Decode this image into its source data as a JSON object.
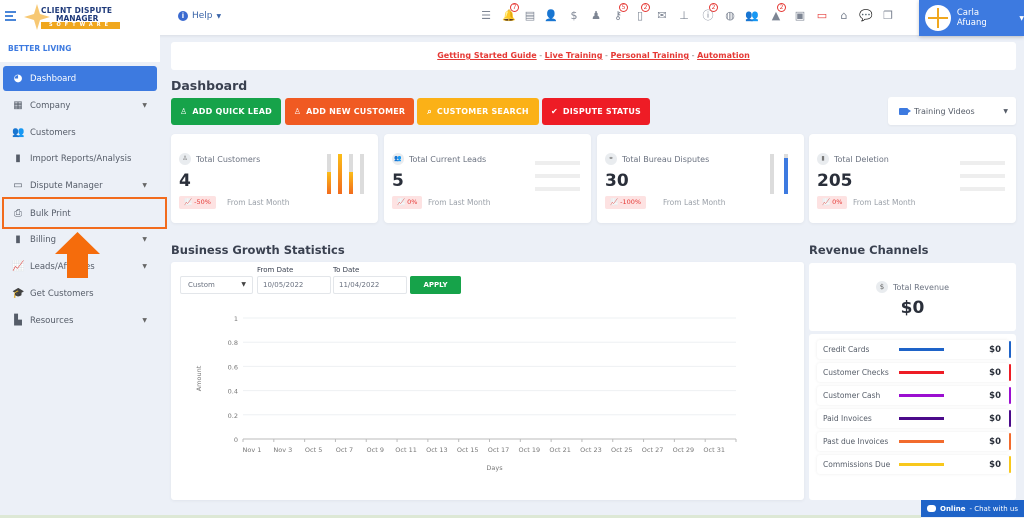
{
  "topbar": {
    "logo": {
      "line1": "CLIENT DISPUTE",
      "line2": "MANAGER",
      "line3": "SOFTWARE"
    },
    "help_label": "Help",
    "icons": [
      {
        "name": "tasks-icon",
        "glyph": "☰",
        "badge": null
      },
      {
        "name": "bell-icon",
        "glyph": "🔔",
        "badge": "7"
      },
      {
        "name": "invoice-icon",
        "glyph": "▤",
        "badge": null
      },
      {
        "name": "agent-icon",
        "glyph": "👤",
        "badge": null
      },
      {
        "name": "dollar-icon",
        "glyph": "$",
        "badge": null
      },
      {
        "name": "user-tie-icon",
        "glyph": "♟",
        "badge": null
      },
      {
        "name": "key-icon",
        "glyph": "⚷",
        "badge": "5"
      },
      {
        "name": "document-icon",
        "glyph": "▯",
        "badge": "2"
      },
      {
        "name": "envelope-icon",
        "glyph": "✉",
        "badge": null
      },
      {
        "name": "sitemap-icon",
        "glyph": "⊥",
        "badge": null
      },
      {
        "name": "info-icon",
        "glyph": "ⓘ",
        "badge": "2"
      },
      {
        "name": "globe-icon",
        "glyph": "◍",
        "badge": null
      },
      {
        "name": "users-icon",
        "glyph": "👥",
        "badge": null
      },
      {
        "name": "warning-icon",
        "glyph": "▲",
        "badge": "2"
      },
      {
        "name": "inbox-icon",
        "glyph": "▣",
        "badge": null
      },
      {
        "name": "money-bill-icon",
        "glyph": "▭",
        "badge": null
      },
      {
        "name": "tray-icon",
        "glyph": "⌂",
        "badge": null
      },
      {
        "name": "comments-icon",
        "glyph": "💬",
        "badge": null
      },
      {
        "name": "copy-icon",
        "glyph": "❐",
        "badge": null
      }
    ],
    "user_name": "Carla Afuang"
  },
  "sidebar": {
    "company": "BETTER LIVING",
    "items": [
      {
        "label": "Dashboard",
        "icon": "◕",
        "active": true,
        "caret": false
      },
      {
        "label": "Company",
        "icon": "▦",
        "active": false,
        "caret": true
      },
      {
        "label": "Customers",
        "icon": "👥",
        "active": false,
        "caret": false
      },
      {
        "label": "Import Reports/Analysis",
        "icon": "▮",
        "active": false,
        "caret": false
      },
      {
        "label": "Dispute Manager",
        "icon": "▭",
        "active": false,
        "caret": true
      },
      {
        "label": "Bulk Print",
        "icon": "⎙",
        "active": false,
        "caret": false
      },
      {
        "label": "Billing",
        "icon": "▮",
        "active": false,
        "caret": true
      },
      {
        "label": "Leads/Affiliates",
        "icon": "📈",
        "active": false,
        "caret": true
      },
      {
        "label": "Get Customers",
        "icon": "🎓",
        "active": false,
        "caret": false
      },
      {
        "label": "Resources",
        "icon": "▙",
        "active": false,
        "caret": true
      }
    ]
  },
  "banner": {
    "links": [
      "Getting Started Guide",
      "Live Training",
      "Personal Training",
      "Automation"
    ],
    "separator": " - "
  },
  "page_title": "Dashboard",
  "quick_buttons": [
    {
      "label": "ADD QUICK LEAD",
      "icon": "♙",
      "color": "#16a34a"
    },
    {
      "label": "ADD NEW CUSTOMER",
      "icon": "♙",
      "color": "#f05a22"
    },
    {
      "label": "CUSTOMER SEARCH",
      "icon": "⌕",
      "color": "#fbb117"
    },
    {
      "label": "DISPUTE STATUS",
      "icon": "✔",
      "color": "#ee1c25"
    }
  ],
  "training_videos": "Training Videos",
  "stats": [
    {
      "title": "Total Customers",
      "value": "4",
      "change": "-50%",
      "from": "From Last Month",
      "icon": "♙",
      "bars": [
        0.55,
        1.0,
        0.55,
        0.0
      ],
      "bar_style": "orange"
    },
    {
      "title": "Total Current Leads",
      "value": "5",
      "change": "0%",
      "from": "From Last Month",
      "icon": "👥",
      "bar_style": "lines"
    },
    {
      "title": "Total Bureau Disputes",
      "value": "30",
      "change": "-100%",
      "from": "From Last Month",
      "icon": "⚭",
      "bars": [
        0.0,
        0.9
      ],
      "bar_style": "blue"
    },
    {
      "title": "Total Deletion",
      "value": "205",
      "change": "0%",
      "from": "From Last Month",
      "icon": "▮",
      "bar_style": "lines"
    }
  ],
  "growth": {
    "title": "Business Growth Statistics",
    "range_select": "Custom",
    "from_label": "From Date",
    "from_value": "10/05/2022",
    "to_label": "To Date",
    "to_value": "11/04/2022",
    "apply_label": "APPLY"
  },
  "chart_data": {
    "type": "line",
    "title": "",
    "xlabel": "Days",
    "ylabel": "Amount",
    "categories": [
      "Nov 1",
      "Nov 3",
      "Oct 5",
      "Oct 7",
      "Oct 9",
      "Oct 11",
      "Oct 13",
      "Oct 15",
      "Oct 17",
      "Oct 19",
      "Oct 21",
      "Oct 23",
      "Oct 25",
      "Oct 27",
      "Oct 29",
      "Oct 31"
    ],
    "series": [],
    "yticks": [
      "0",
      "0.2",
      "0.4",
      "0.6",
      "0.8",
      "1"
    ],
    "ylim": [
      0,
      1
    ],
    "grid": true
  },
  "revenue": {
    "title": "Revenue Channels",
    "total_label": "Total Revenue",
    "total_value": "$0",
    "channels": [
      {
        "label": "Credit Cards",
        "value": "$0",
        "color": "#1e63c8"
      },
      {
        "label": "Customer Checks",
        "value": "$0",
        "color": "#ee1c25"
      },
      {
        "label": "Customer Cash",
        "value": "$0",
        "color": "#9b0fd0"
      },
      {
        "label": "Paid Invoices",
        "value": "$0",
        "color": "#4b0a8a"
      },
      {
        "label": "Past due Invoices",
        "value": "$0",
        "color": "#f26b2d"
      },
      {
        "label": "Commissions Due",
        "value": "$0",
        "color": "#f8c81c"
      }
    ]
  },
  "chat": {
    "status": "Online",
    "text": " - Chat with us"
  }
}
